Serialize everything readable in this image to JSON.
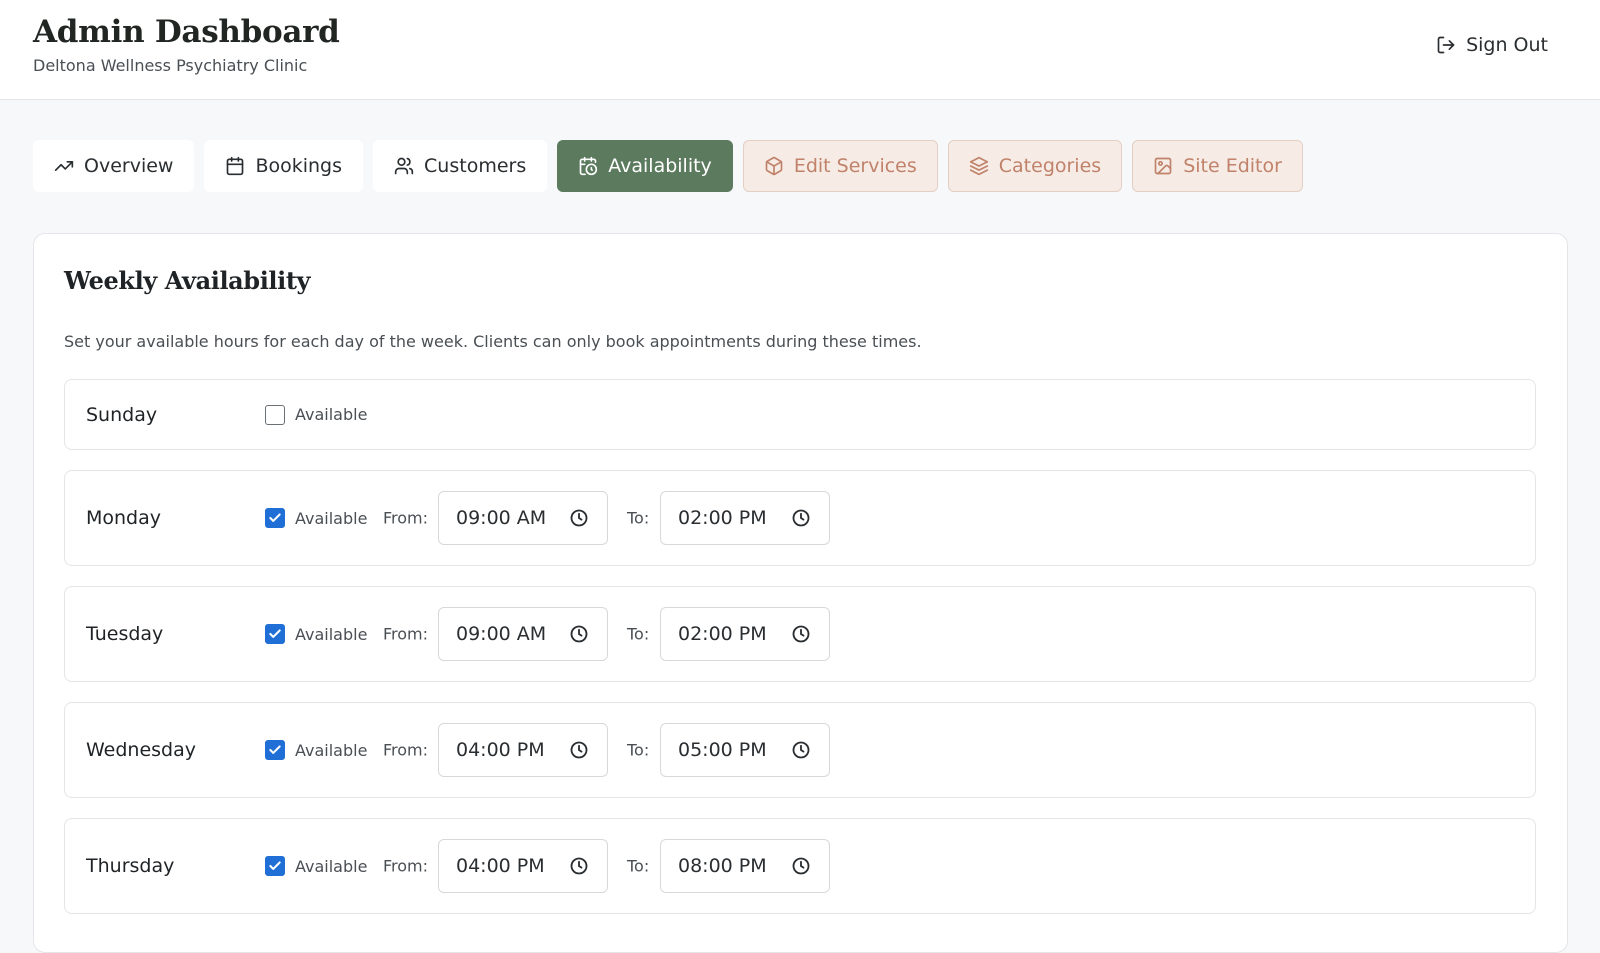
{
  "header": {
    "title": "Admin Dashboard",
    "subtitle": "Deltona Wellness Psychiatry Clinic",
    "signout_label": "Sign Out"
  },
  "tabs": [
    {
      "label": "Overview",
      "icon": "trending-up-icon",
      "state": "default"
    },
    {
      "label": "Bookings",
      "icon": "calendar-icon",
      "state": "default"
    },
    {
      "label": "Customers",
      "icon": "users-icon",
      "state": "default"
    },
    {
      "label": "Availability",
      "icon": "calendar-clock-icon",
      "state": "active"
    },
    {
      "label": "Edit Services",
      "icon": "package-icon",
      "state": "warm"
    },
    {
      "label": "Categories",
      "icon": "layers-icon",
      "state": "warm"
    },
    {
      "label": "Site Editor",
      "icon": "image-icon",
      "state": "warm"
    }
  ],
  "availability": {
    "title": "Weekly Availability",
    "description": "Set your available hours for each day of the week. Clients can only book appointments during these times.",
    "available_label": "Available",
    "from_label": "From:",
    "to_label": "To:",
    "days": [
      {
        "name": "Sunday",
        "available": false,
        "from": "",
        "to": ""
      },
      {
        "name": "Monday",
        "available": true,
        "from": "09:00  AM",
        "to": "02:00  PM"
      },
      {
        "name": "Tuesday",
        "available": true,
        "from": "09:00  AM",
        "to": "02:00  PM"
      },
      {
        "name": "Wednesday",
        "available": true,
        "from": "04:00  PM",
        "to": "05:00  PM"
      },
      {
        "name": "Thursday",
        "available": true,
        "from": "04:00  PM",
        "to": "08:00  PM"
      }
    ]
  },
  "colors": {
    "active_tab": "#5b7a5e",
    "warm_tab_bg": "#f6ebe5",
    "warm_tab_text": "#c0826a",
    "checkbox_checked": "#1f6fd6"
  }
}
